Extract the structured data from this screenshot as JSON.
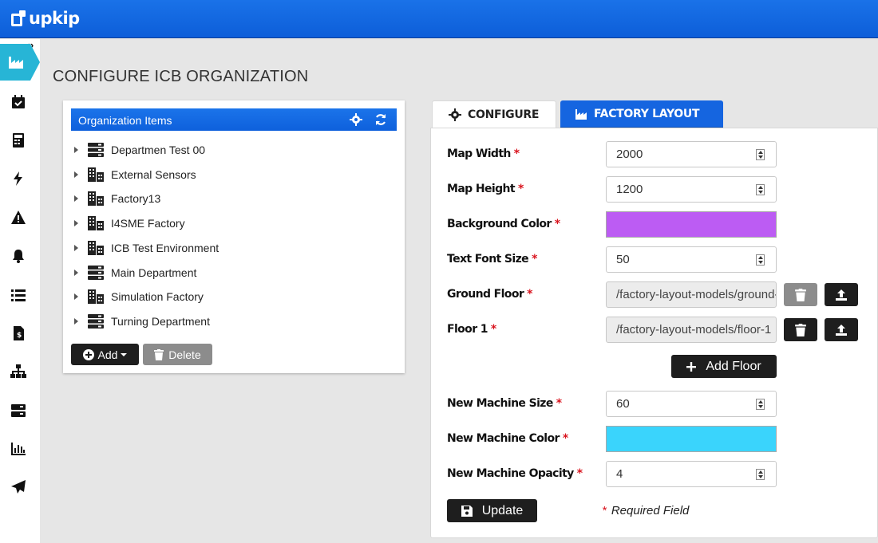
{
  "app": {
    "logo_text": "upkip"
  },
  "sidebar": {
    "toggle": "»",
    "items": [
      {
        "icon": "factory-icon",
        "active": true
      },
      {
        "icon": "calendar-check-icon"
      },
      {
        "icon": "calculator-icon"
      },
      {
        "icon": "bolt-icon"
      },
      {
        "icon": "warning-icon"
      },
      {
        "icon": "bell-icon"
      },
      {
        "icon": "list-icon"
      },
      {
        "icon": "invoice-icon"
      },
      {
        "icon": "sitemap-icon"
      },
      {
        "icon": "server-icon"
      },
      {
        "icon": "bar-chart-icon"
      },
      {
        "icon": "paper-plane-icon"
      }
    ]
  },
  "page": {
    "title": "CONFIGURE ICB ORGANIZATION"
  },
  "org_panel": {
    "title": "Organization Items",
    "items": [
      {
        "label": "Departmen Test 00",
        "type": "server"
      },
      {
        "label": "External Sensors",
        "type": "building"
      },
      {
        "label": "Factory13",
        "type": "building"
      },
      {
        "label": "I4SME Factory",
        "type": "building"
      },
      {
        "label": "ICB Test Environment",
        "type": "building"
      },
      {
        "label": "Main Department",
        "type": "server"
      },
      {
        "label": "Simulation Factory",
        "type": "building"
      },
      {
        "label": "Turning Department",
        "type": "server"
      }
    ],
    "add_label": "Add",
    "delete_label": "Delete"
  },
  "tabs": {
    "configure": "CONFIGURE",
    "factory_layout": "FACTORY LAYOUT"
  },
  "form": {
    "map_width": {
      "label": "Map Width",
      "value": "2000"
    },
    "map_height": {
      "label": "Map Height",
      "value": "1200"
    },
    "background_color": {
      "label": "Background Color",
      "value": "#bc5cf3"
    },
    "text_font_size": {
      "label": "Text Font Size",
      "value": "50"
    },
    "ground_floor": {
      "label": "Ground Floor",
      "value": "/factory-layout-models/ground-floor"
    },
    "floor_1": {
      "label": "Floor 1",
      "value": "/factory-layout-models/floor-1"
    },
    "add_floor_label": "Add Floor",
    "new_machine_size": {
      "label": "New Machine Size",
      "value": "60"
    },
    "new_machine_color": {
      "label": "New Machine Color",
      "value": "#3ad4fc"
    },
    "new_machine_opacity": {
      "label": "New Machine Opacity",
      "value": "4"
    },
    "update_label": "Update",
    "required_mark": "*",
    "required_note": "Required Field"
  },
  "colors": {
    "brand_blue": "#1565e0",
    "sidebar_active": "#27b5d6",
    "required_red": "#d9141e"
  }
}
